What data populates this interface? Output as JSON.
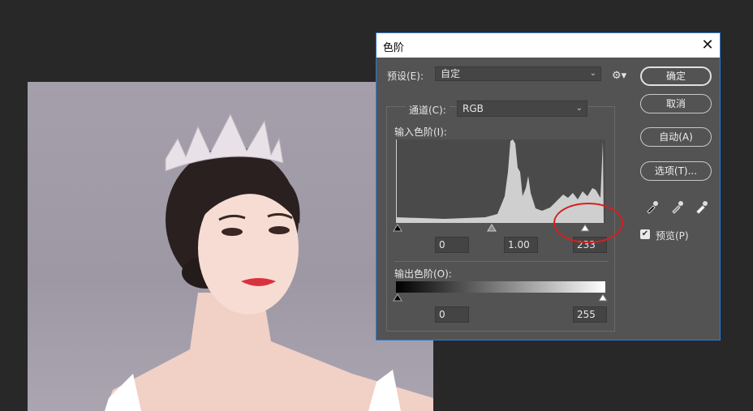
{
  "dialog": {
    "title": "色阶",
    "preset_label": "预设(E):",
    "preset_value": "自定",
    "channel_label": "通道(C):",
    "channel_value": "RGB",
    "input_levels_label": "输入色阶(I):",
    "input_black": "0",
    "input_gamma": "1.00",
    "input_white": "233",
    "output_levels_label": "输出色阶(O):",
    "output_black": "0",
    "output_white": "255",
    "buttons": {
      "ok": "确定",
      "cancel": "取消",
      "auto": "自动(A)",
      "options": "选项(T)..."
    },
    "preview_label": "预览(P)",
    "preview_checked": true
  },
  "icons": {
    "close": "close-icon",
    "gear": "gear-icon",
    "eyedroppers": [
      "black-eyedropper-icon",
      "gray-eyedropper-icon",
      "white-eyedropper-icon"
    ]
  },
  "colors": {
    "dialog_bg": "#535353",
    "highlight_circle": "#d42020",
    "accent_border": "#2d7bd0"
  }
}
